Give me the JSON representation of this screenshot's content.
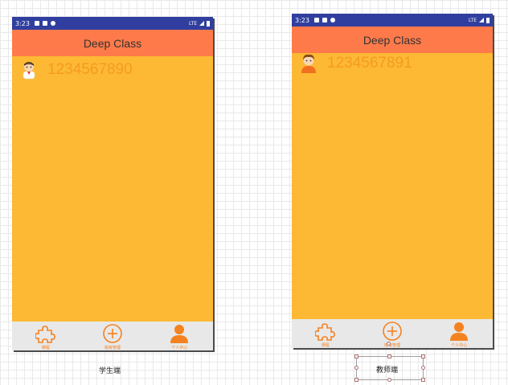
{
  "student": {
    "status_time": "3:23",
    "network": "LTE",
    "app_title": "Deep Class",
    "user_id": "1234567890",
    "tabs": [
      {
        "label": "课程",
        "icon": "puzzle-icon"
      },
      {
        "label": "班级管理",
        "icon": "plus-circle-icon"
      },
      {
        "label": "个人中心",
        "icon": "person-icon"
      }
    ],
    "caption": "学生端"
  },
  "teacher": {
    "status_time": "3:23",
    "network": "LTE",
    "app_title": "Deep Class",
    "user_id": "1234567891",
    "tabs": [
      {
        "label": "课程",
        "icon": "puzzle-icon"
      },
      {
        "label": "班级管理",
        "icon": "plus-circle-icon"
      },
      {
        "label": "个人中心",
        "icon": "person-icon"
      }
    ],
    "caption": "教师端"
  },
  "colors": {
    "status_bar": "#303f9f",
    "app_bar": "#ff7a4a",
    "body": "#fdb933",
    "accent": "#f58220",
    "tab_bar": "#e8e8e8"
  }
}
